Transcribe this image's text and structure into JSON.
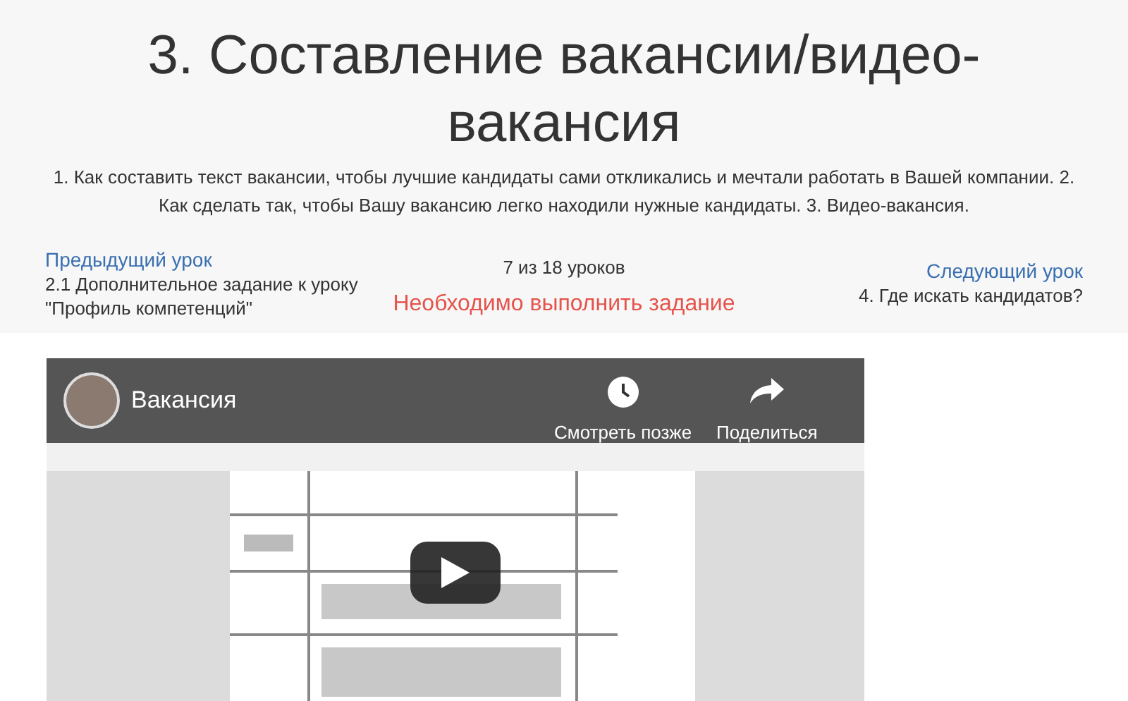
{
  "lesson": {
    "title": "3. Составление вакансии/видео-вакансия",
    "description": "1. Как составить текст вакансии, чтобы лучшие кандидаты сами откликались и мечтали работать в Вашей компании. 2. Как сделать так, чтобы Вашу вакансию легко находили нужные кандидаты. 3. Видео-вакансия."
  },
  "navigation": {
    "previous": {
      "label": "Предыдущий урок",
      "title": "2.1 Дополнительное задание к уроку \"Профиль компетенций\""
    },
    "progress": "7 из 18 уроков",
    "requirement": "Необходимо выполнить задание",
    "next": {
      "label": "Следующий урок",
      "title": "4. Где искать кандидатов?"
    }
  },
  "video": {
    "kind": "picture",
    "title": "Вакансия",
    "watch_later": "Смотреть позже",
    "share": "Поделиться"
  }
}
